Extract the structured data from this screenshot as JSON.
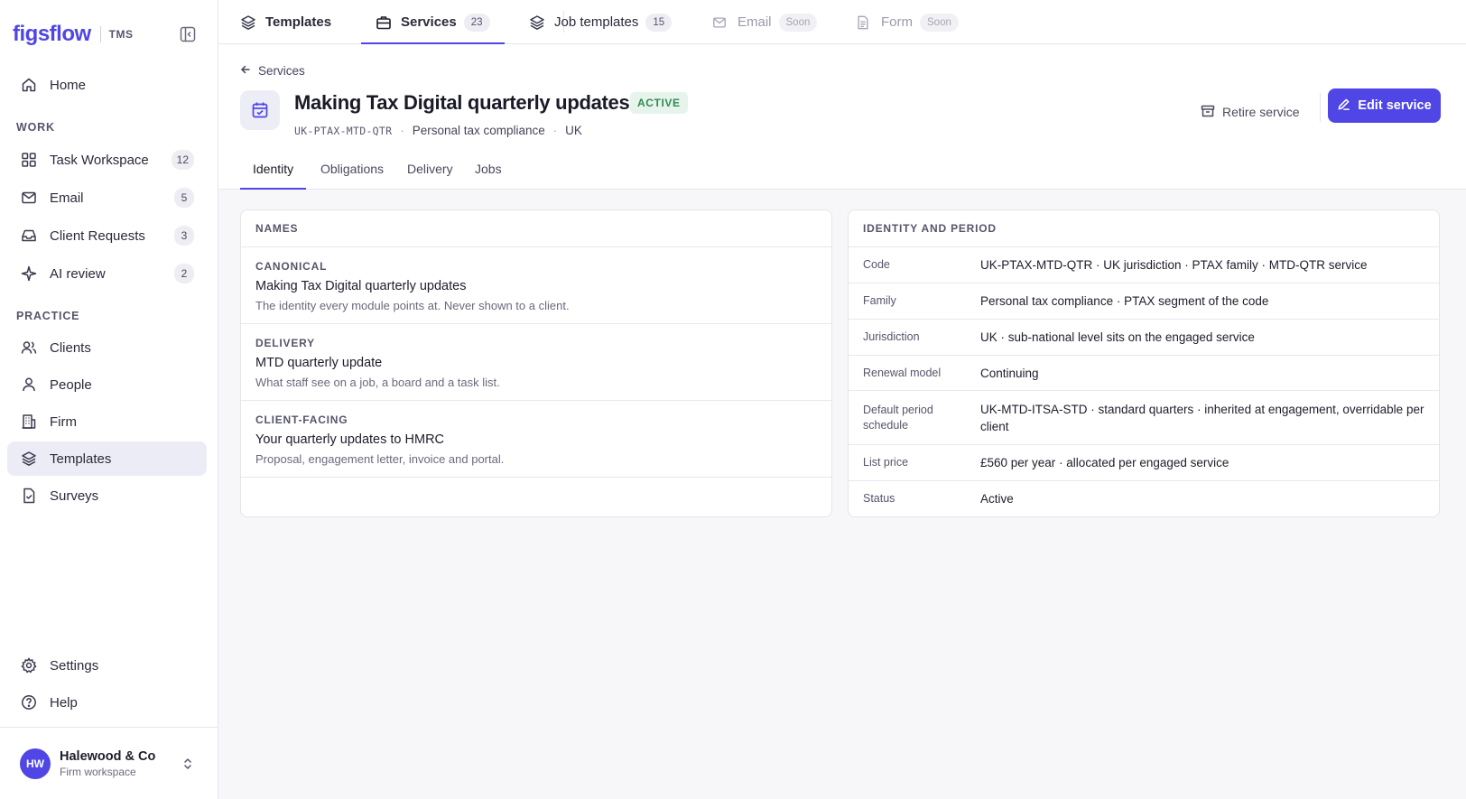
{
  "brand": {
    "logo": "figsflow",
    "product": "TMS"
  },
  "sidebar": {
    "home": "Home",
    "sections": {
      "work": "WORK",
      "practice": "PRACTICE"
    },
    "work_items": [
      {
        "label": "Task Workspace",
        "count": "12",
        "icon": "grid-icon"
      },
      {
        "label": "Email",
        "count": "5",
        "icon": "mail-icon"
      },
      {
        "label": "Client Requests",
        "count": "3",
        "icon": "inbox-icon"
      },
      {
        "label": "AI review",
        "count": "2",
        "icon": "sparkle-icon"
      }
    ],
    "practice_items": [
      {
        "label": "Clients",
        "icon": "users-icon"
      },
      {
        "label": "People",
        "icon": "user-icon"
      },
      {
        "label": "Firm",
        "icon": "building-icon"
      },
      {
        "label": "Templates",
        "icon": "layers-icon",
        "active": true
      },
      {
        "label": "Surveys",
        "icon": "file-check-icon"
      }
    ],
    "settings": "Settings",
    "help": "Help",
    "workspace": {
      "initials": "HW",
      "name": "Halewood & Co",
      "subtitle": "Firm workspace"
    }
  },
  "top_tabs": [
    {
      "label": "Templates"
    },
    {
      "label": "Services",
      "count": "23",
      "active": true
    },
    {
      "label": "Job templates",
      "count": "15"
    },
    {
      "label": "Email",
      "badge": "Soon",
      "disabled": true
    },
    {
      "label": "Form",
      "badge": "Soon",
      "disabled": true
    }
  ],
  "header": {
    "back_label": "Services",
    "title": "Making Tax Digital quarterly updates",
    "status": "ACTIVE",
    "code": "UK-PTAX-MTD-QTR",
    "family": "Personal tax compliance",
    "jurisdiction": "UK",
    "retire_label": "Retire service",
    "edit_label": "Edit service"
  },
  "sub_tabs": [
    "Identity",
    "Obligations",
    "Delivery",
    "Jobs"
  ],
  "names_card": {
    "title": "NAMES",
    "rows": [
      {
        "caption": "CANONICAL",
        "value": "Making Tax Digital quarterly updates",
        "description": "The identity every module points at. Never shown to a client."
      },
      {
        "caption": "DELIVERY",
        "value": "MTD quarterly update",
        "description": "What staff see on a job, a board and a task list."
      },
      {
        "caption": "CLIENT-FACING",
        "value": "Your quarterly updates to HMRC",
        "description": "Proposal, engagement letter, invoice and portal."
      }
    ]
  },
  "identity_card": {
    "title": "IDENTITY AND PERIOD",
    "rows": [
      {
        "key": "Code",
        "value": "UK-PTAX-MTD-QTR · UK jurisdiction · PTAX family · MTD-QTR service"
      },
      {
        "key": "Family",
        "value": "Personal tax compliance · PTAX segment of the code"
      },
      {
        "key": "Jurisdiction",
        "value": "UK · sub-national level sits on the engaged service"
      },
      {
        "key": "Renewal model",
        "value": "Continuing"
      },
      {
        "key": "Default period schedule",
        "value": "UK-MTD-ITSA-STD · standard quarters · inherited at engagement, overridable per client"
      },
      {
        "key": "List price",
        "value": "£560 per year · allocated per engaged service"
      },
      {
        "key": "Status",
        "value": "Active"
      }
    ]
  },
  "colors": {
    "accent": "#4f46e5",
    "active_badge_bg": "#e6f4ec",
    "active_badge_text": "#2f8a55"
  }
}
